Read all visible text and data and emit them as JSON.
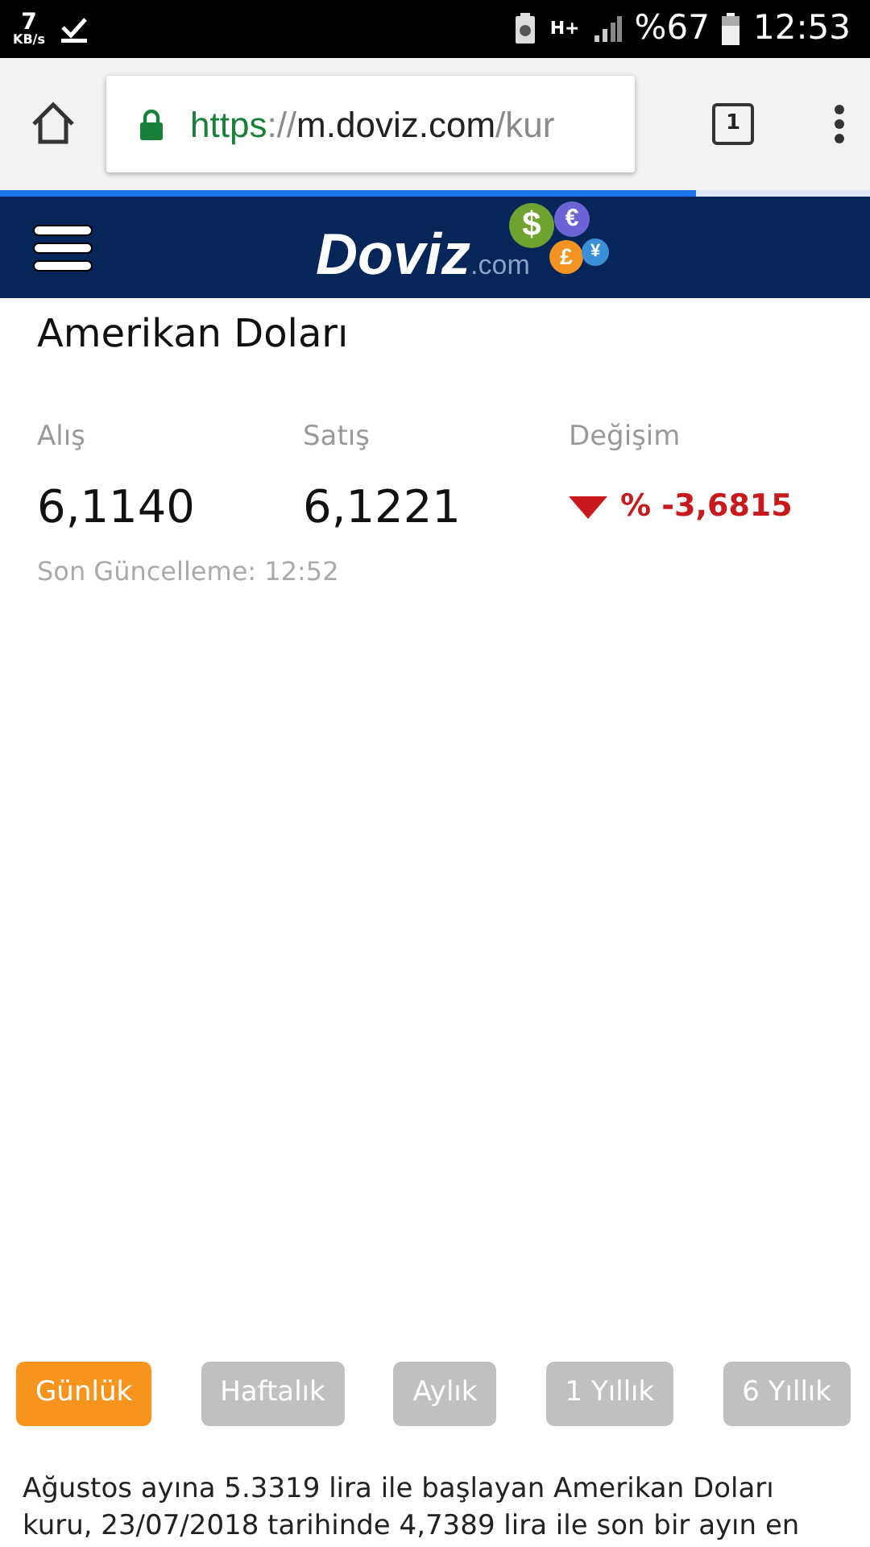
{
  "status_bar": {
    "speed": "7",
    "speed_unit": "KB/s",
    "network": "H+",
    "battery": "%67",
    "time": "12:53"
  },
  "browser": {
    "url": {
      "scheme": "https",
      "separator": "://",
      "host": "m.doviz.com",
      "path": "/kur"
    },
    "tab_count": "1",
    "load_progress": {
      "level": 0.8
    }
  },
  "header": {
    "logo": {
      "name": "Doviz",
      "suffix": ".com",
      "coins": [
        {
          "symbol": "$",
          "color": "#6fa22f"
        },
        {
          "symbol": "€",
          "color": "#6b63d6"
        },
        {
          "symbol": "£",
          "color": "#f39322"
        },
        {
          "symbol": "¥",
          "color": "#3a8fd8"
        }
      ]
    }
  },
  "currency": {
    "title": "Amerikan Doları",
    "columns": [
      {
        "kind": "rate",
        "label": "Alış",
        "value": "6,1140"
      },
      {
        "kind": "rate",
        "label": "Satış",
        "value": "6,1221"
      },
      {
        "kind": "down",
        "label": "Değişim",
        "value": "% -3,6815"
      }
    ],
    "updated": "Son Güncelleme: 12:52"
  },
  "periods": [
    {
      "label": "Günlük",
      "selected": true
    },
    {
      "label": "Haftalık",
      "selected": false
    },
    {
      "label": "Aylık",
      "selected": false
    },
    {
      "label": "1 Yıllık",
      "selected": false
    },
    {
      "label": "6 Yıllık",
      "selected": false
    }
  ],
  "description": "Ağustos ayına 5.3319 lira ile başlayan Amerikan Doları kuru, 23/07/2018 tarihinde 4,7389 lira ile son bir ayın en"
}
